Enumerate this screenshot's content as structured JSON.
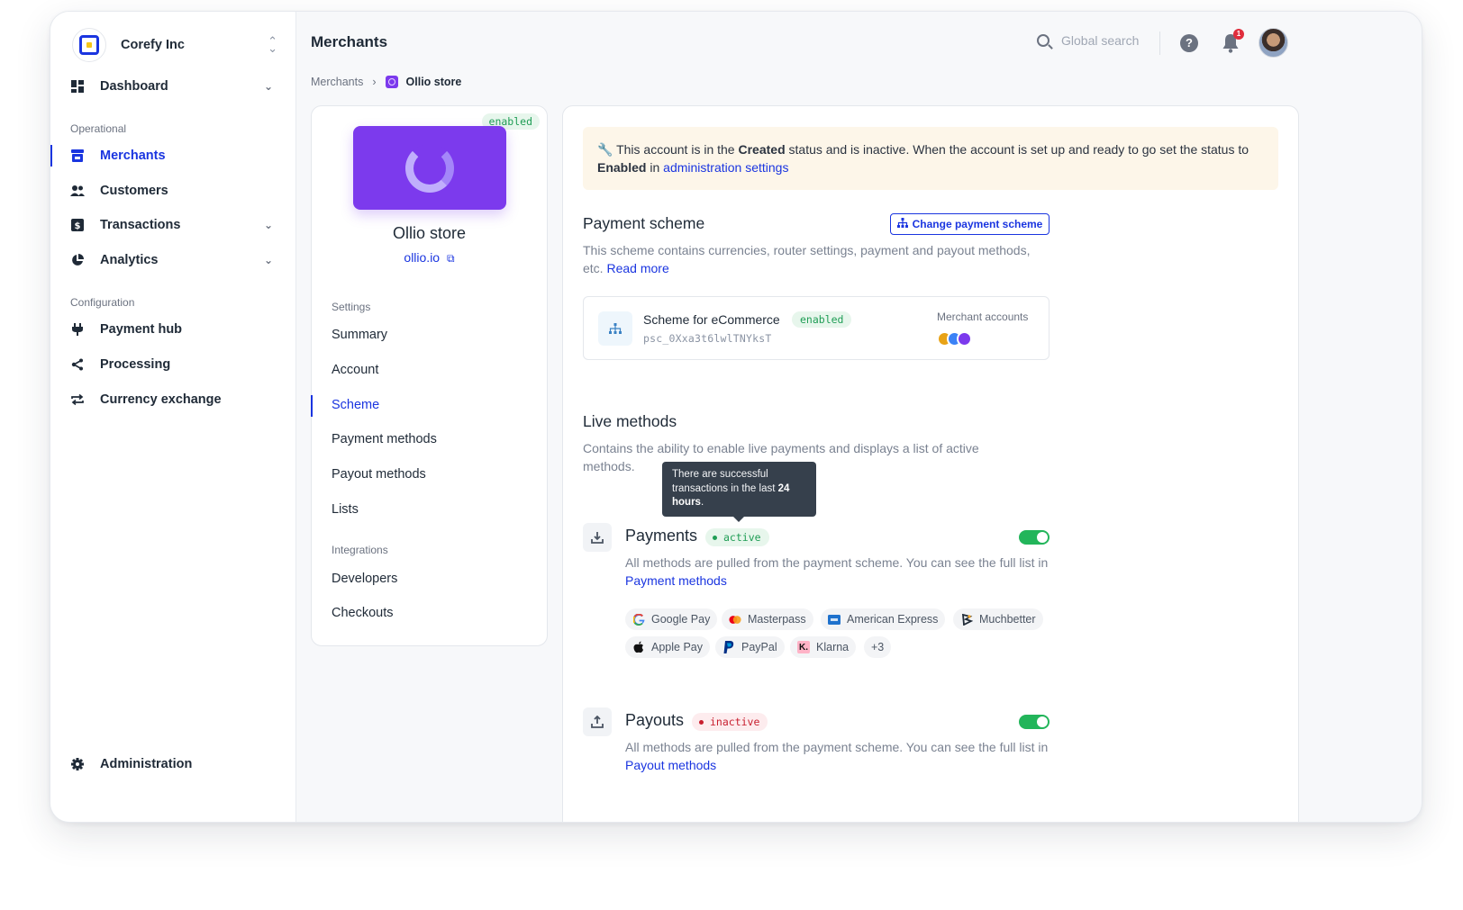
{
  "org": {
    "name": "Corefy Inc"
  },
  "sidebar": {
    "dashboard": "Dashboard",
    "operational_label": "Operational",
    "merchants": "Merchants",
    "customers": "Customers",
    "transactions": "Transactions",
    "analytics": "Analytics",
    "configuration_label": "Configuration",
    "payment_hub": "Payment hub",
    "processing": "Processing",
    "currency_exchange": "Currency exchange",
    "administration": "Administration"
  },
  "header": {
    "title": "Merchants",
    "search_placeholder": "Global search",
    "help": "?",
    "notifications_count": "1"
  },
  "breadcrumb": {
    "parent": "Merchants",
    "current": "Ollio store"
  },
  "merchant": {
    "status": "enabled",
    "name": "Ollio store",
    "link": "ollio.io",
    "settings_label": "Settings",
    "menu": {
      "summary": "Summary",
      "account": "Account",
      "scheme": "Scheme",
      "payment_methods": "Payment methods",
      "payout_methods": "Payout methods",
      "lists": "Lists"
    },
    "integrations_label": "Integrations",
    "integrations": {
      "developers": "Developers",
      "checkouts": "Checkouts"
    }
  },
  "alert": {
    "icon": "🔧",
    "part1": "This account is in the ",
    "created": "Created",
    "part2": " status and is inactive. When the account is set up and ready to go set the status to ",
    "enabled": "Enabled",
    "part3": " in ",
    "link": "administration settings"
  },
  "payment_scheme": {
    "title": "Payment scheme",
    "button": "Change payment scheme",
    "desc": "This scheme contains currencies, router settings, payment and payout methods, etc.",
    "read_more": "Read more",
    "scheme_name": "Scheme for eCommerce",
    "scheme_status": "enabled",
    "scheme_id": "psc_0Xxa3t6lwlTNYksT",
    "merchant_accounts_label": "Merchant accounts",
    "account_colors": [
      "#e8a317",
      "#3b82f6",
      "#7c3aed"
    ]
  },
  "live_methods": {
    "title": "Live methods",
    "desc": "Contains the ability to enable live payments and displays a list of active methods.",
    "tooltip_text": "There are successful transactions in the last ",
    "tooltip_bold": "24 hours",
    "tooltip_end": ".",
    "payments": {
      "title": "Payments",
      "status": "active",
      "desc": "All methods are pulled from the payment scheme. You can see the full list in",
      "link": "Payment methods",
      "enabled": true
    },
    "methods": [
      "Google Pay",
      "Masterpass",
      "American Express",
      "Muchbetter",
      "Apple Pay",
      "PayPal",
      "Klarna"
    ],
    "more": "+3",
    "payouts": {
      "title": "Payouts",
      "status": "inactive",
      "desc": "All methods are pulled from the payment scheme. You can see the full list in",
      "link": "Payout methods",
      "enabled": true
    }
  }
}
